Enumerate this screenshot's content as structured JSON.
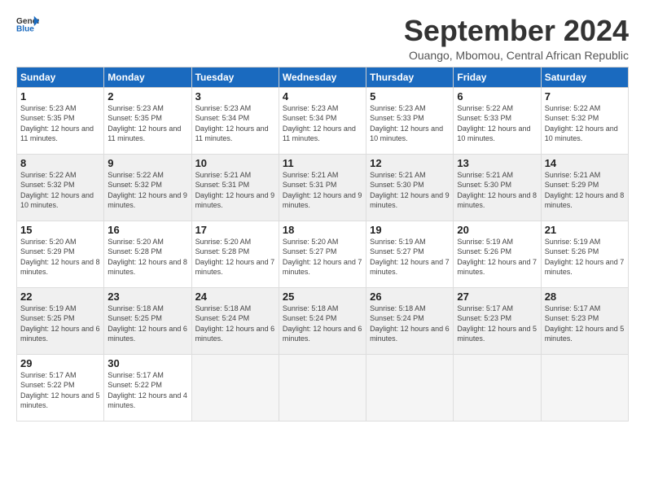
{
  "logo": {
    "general": "General",
    "blue": "Blue"
  },
  "title": "September 2024",
  "subtitle": "Ouango, Mbomou, Central African Republic",
  "headers": [
    "Sunday",
    "Monday",
    "Tuesday",
    "Wednesday",
    "Thursday",
    "Friday",
    "Saturday"
  ],
  "weeks": [
    [
      {
        "day": "1",
        "sunrise": "5:23 AM",
        "sunset": "5:35 PM",
        "daylight": "12 hours and 11 minutes."
      },
      {
        "day": "2",
        "sunrise": "5:23 AM",
        "sunset": "5:35 PM",
        "daylight": "12 hours and 11 minutes."
      },
      {
        "day": "3",
        "sunrise": "5:23 AM",
        "sunset": "5:34 PM",
        "daylight": "12 hours and 11 minutes."
      },
      {
        "day": "4",
        "sunrise": "5:23 AM",
        "sunset": "5:34 PM",
        "daylight": "12 hours and 11 minutes."
      },
      {
        "day": "5",
        "sunrise": "5:23 AM",
        "sunset": "5:33 PM",
        "daylight": "12 hours and 10 minutes."
      },
      {
        "day": "6",
        "sunrise": "5:22 AM",
        "sunset": "5:33 PM",
        "daylight": "12 hours and 10 minutes."
      },
      {
        "day": "7",
        "sunrise": "5:22 AM",
        "sunset": "5:32 PM",
        "daylight": "12 hours and 10 minutes."
      }
    ],
    [
      {
        "day": "8",
        "sunrise": "5:22 AM",
        "sunset": "5:32 PM",
        "daylight": "12 hours and 10 minutes."
      },
      {
        "day": "9",
        "sunrise": "5:22 AM",
        "sunset": "5:32 PM",
        "daylight": "12 hours and 9 minutes."
      },
      {
        "day": "10",
        "sunrise": "5:21 AM",
        "sunset": "5:31 PM",
        "daylight": "12 hours and 9 minutes."
      },
      {
        "day": "11",
        "sunrise": "5:21 AM",
        "sunset": "5:31 PM",
        "daylight": "12 hours and 9 minutes."
      },
      {
        "day": "12",
        "sunrise": "5:21 AM",
        "sunset": "5:30 PM",
        "daylight": "12 hours and 9 minutes."
      },
      {
        "day": "13",
        "sunrise": "5:21 AM",
        "sunset": "5:30 PM",
        "daylight": "12 hours and 8 minutes."
      },
      {
        "day": "14",
        "sunrise": "5:21 AM",
        "sunset": "5:29 PM",
        "daylight": "12 hours and 8 minutes."
      }
    ],
    [
      {
        "day": "15",
        "sunrise": "5:20 AM",
        "sunset": "5:29 PM",
        "daylight": "12 hours and 8 minutes."
      },
      {
        "day": "16",
        "sunrise": "5:20 AM",
        "sunset": "5:28 PM",
        "daylight": "12 hours and 8 minutes."
      },
      {
        "day": "17",
        "sunrise": "5:20 AM",
        "sunset": "5:28 PM",
        "daylight": "12 hours and 7 minutes."
      },
      {
        "day": "18",
        "sunrise": "5:20 AM",
        "sunset": "5:27 PM",
        "daylight": "12 hours and 7 minutes."
      },
      {
        "day": "19",
        "sunrise": "5:19 AM",
        "sunset": "5:27 PM",
        "daylight": "12 hours and 7 minutes."
      },
      {
        "day": "20",
        "sunrise": "5:19 AM",
        "sunset": "5:26 PM",
        "daylight": "12 hours and 7 minutes."
      },
      {
        "day": "21",
        "sunrise": "5:19 AM",
        "sunset": "5:26 PM",
        "daylight": "12 hours and 7 minutes."
      }
    ],
    [
      {
        "day": "22",
        "sunrise": "5:19 AM",
        "sunset": "5:25 PM",
        "daylight": "12 hours and 6 minutes."
      },
      {
        "day": "23",
        "sunrise": "5:18 AM",
        "sunset": "5:25 PM",
        "daylight": "12 hours and 6 minutes."
      },
      {
        "day": "24",
        "sunrise": "5:18 AM",
        "sunset": "5:24 PM",
        "daylight": "12 hours and 6 minutes."
      },
      {
        "day": "25",
        "sunrise": "5:18 AM",
        "sunset": "5:24 PM",
        "daylight": "12 hours and 6 minutes."
      },
      {
        "day": "26",
        "sunrise": "5:18 AM",
        "sunset": "5:24 PM",
        "daylight": "12 hours and 6 minutes."
      },
      {
        "day": "27",
        "sunrise": "5:17 AM",
        "sunset": "5:23 PM",
        "daylight": "12 hours and 5 minutes."
      },
      {
        "day": "28",
        "sunrise": "5:17 AM",
        "sunset": "5:23 PM",
        "daylight": "12 hours and 5 minutes."
      }
    ],
    [
      {
        "day": "29",
        "sunrise": "5:17 AM",
        "sunset": "5:22 PM",
        "daylight": "12 hours and 5 minutes."
      },
      {
        "day": "30",
        "sunrise": "5:17 AM",
        "sunset": "5:22 PM",
        "daylight": "12 hours and 4 minutes."
      },
      null,
      null,
      null,
      null,
      null
    ]
  ]
}
